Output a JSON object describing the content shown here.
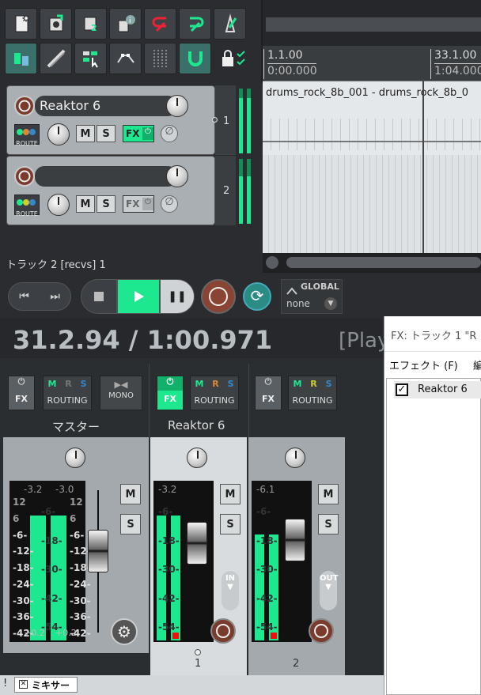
{
  "toolbar": {
    "row1": [
      "new-project-icon",
      "save-project-icon",
      "project-settings-icon",
      "project-info-icon",
      "undo-icon",
      "redo-icon",
      "metronome-icon"
    ],
    "row2": [
      "ripple-edit-icon",
      "grid-snap-icon",
      "grouping-icon",
      "envelope-points-icon",
      "grid-icon",
      "snap-icon",
      "lock-icon"
    ]
  },
  "timeline": {
    "marker1_bars": "1.1.00",
    "marker1_time": "0:00.000",
    "marker2_bars": "33.1.00",
    "marker2_time": "1:04.000",
    "item_label": "drums_rock_8b_001 - drums_rock_8b_0"
  },
  "tracks": [
    {
      "name": "Reaktor 6",
      "number": "1",
      "route": "ROUTE",
      "mute": "M",
      "solo": "S",
      "fx": "FX"
    },
    {
      "name": "",
      "number": "2",
      "route": "ROUTE",
      "mute": "M",
      "solo": "S",
      "fx": "FX"
    }
  ],
  "track_status": "トラック 2 [recvs] 1",
  "transport": {
    "global_label": "GLOBAL",
    "global_value": "none",
    "position": "31.2.94 / 1:00.971",
    "state": "[Play"
  },
  "fx_window": {
    "title": "FX: トラック 1 \"R",
    "menu_effect": "エフェクト (F)",
    "menu_next": "編",
    "item": "Reaktor 6"
  },
  "mixer": {
    "fx": "FX",
    "routing": "ROUTING",
    "mono": "MONO",
    "m": "M",
    "r": "R",
    "s": "S",
    "master": {
      "name": "マスター",
      "peak_l": "-3.2",
      "peak_r": "-3.0",
      "foot_l": "+0.2",
      "foot_r": "+0.2"
    },
    "ch1": {
      "name": "Reaktor 6",
      "peak": "-3.2",
      "number": "1",
      "io": "IN"
    },
    "ch2": {
      "name": "",
      "peak": "-6.1",
      "number": "2",
      "io": "OUT"
    },
    "scale": [
      "12",
      "6",
      "-6-",
      "-12-",
      "-18-",
      "-24-",
      "-30-",
      "-36-",
      "-42-"
    ],
    "scale2": [
      "-6-",
      "-18-",
      "-30-",
      "-42-",
      "-54-"
    ],
    "mute": "M",
    "solo": "S"
  },
  "bottom_tab": "ミキサー",
  "bottom_excl": "!"
}
